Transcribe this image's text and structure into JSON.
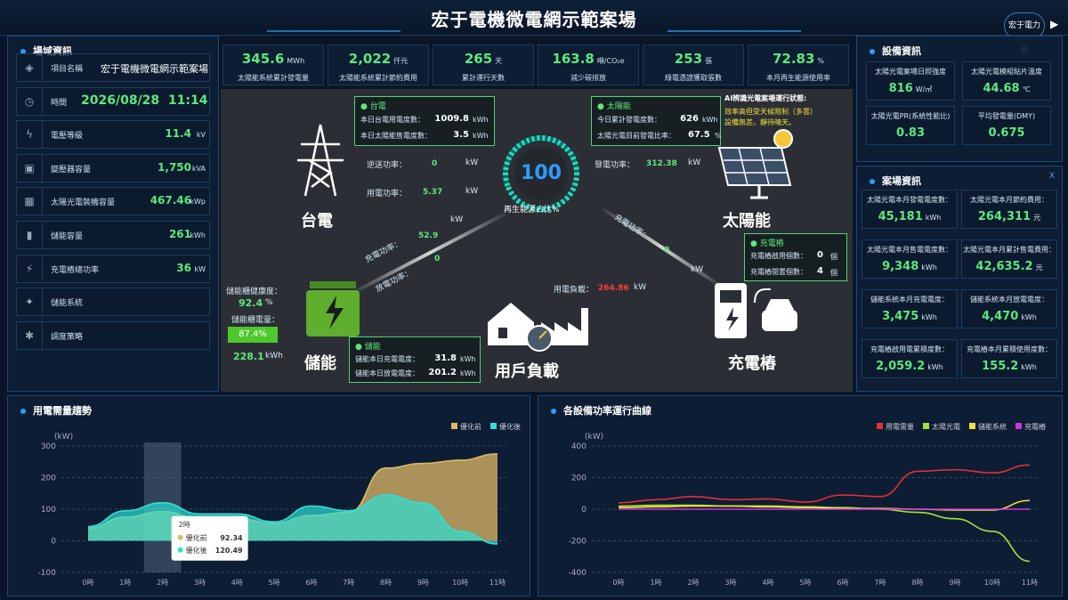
{
  "header": {
    "title": "宏于電機微電網示範案場",
    "brand": "宏于電力會"
  },
  "left": {
    "title": "場域資訊",
    "rows": [
      {
        "icon": "layers-icon",
        "label": "項目名稱",
        "value": "宏于電機微電網示範案場",
        "unit": ""
      },
      {
        "icon": "clock-icon",
        "label": "時間",
        "value": "2026/08/28  11:14",
        "unit": ""
      },
      {
        "icon": "voltage-icon",
        "label": "電壓等級",
        "value": "11.4",
        "unit": "kV"
      },
      {
        "icon": "transformer-icon",
        "label": "變壓器容量",
        "value": "1,750",
        "unit": "kVA"
      },
      {
        "icon": "solar-install-icon",
        "label": "太陽光電裝機容量",
        "value": "467.46",
        "unit": "kWp"
      },
      {
        "icon": "battery-icon",
        "label": "儲能容量",
        "value": "261",
        "unit": "kWh"
      },
      {
        "icon": "charger-icon",
        "label": "充電樁總功率",
        "value": "36",
        "unit": "kW"
      },
      {
        "icon": "storage-system-icon",
        "label": "儲能系統",
        "value": "",
        "unit": ""
      },
      {
        "icon": "strategy-icon",
        "label": "調度策略",
        "value": "",
        "unit": ""
      }
    ]
  },
  "kpis": [
    {
      "value": "345.6",
      "unit": "MWh",
      "label": "太陽能系統累計發電量"
    },
    {
      "value": "2,022",
      "unit": "仟元",
      "label": "太陽能系統累計節約費用"
    },
    {
      "value": "265",
      "unit": "天",
      "label": "累計運行天數"
    },
    {
      "value": "163.8",
      "unit": "噸/CO₂e",
      "label": "減少碳排放"
    },
    {
      "value": "253",
      "unit": "張",
      "label": "綠電憑證獲取張數"
    },
    {
      "value": "72.83",
      "unit": "%",
      "label": "本月再生能源使用率"
    }
  ],
  "flow": {
    "grid": {
      "name": "台電",
      "box_title": "台電",
      "r1": "本日台電用電度數：",
      "v1": "1009.8",
      "u1": "kWh",
      "r2": "本日太陽能售電度數：",
      "v2": "3.5",
      "u2": "kWh",
      "export_label": "逆送功率：",
      "export_value": "0",
      "import_label": "用電功率：",
      "import_value": "5.37",
      "unit": "kW"
    },
    "solar": {
      "name": "太陽能",
      "box_title": "太陽能",
      "r1": "今日累計發電度數：",
      "v1": "626",
      "u1": "kWh",
      "r2": "太陽光電目前發電比率：",
      "v2": "67.5",
      "u2": "%",
      "gen_label": "發電功率：",
      "gen_value": "312.38",
      "unit": "kW"
    },
    "ai": {
      "title": "AI辨識光電案場運行狀態:",
      "msg1": "效率高但受天候限制（多雲）",
      "msg2": "設備無恙，靜待晴天。"
    },
    "renewable": {
      "value": "100",
      "label": "再生能源占比%"
    },
    "storage": {
      "name": "儲能",
      "box_title": "儲能",
      "r1": "儲能本日充電電度：",
      "v1": "31.8",
      "u1": "kWh",
      "r2": "儲能本日放電電度：",
      "v2": "201.2",
      "u2": "kWh",
      "health_label": "儲能櫃健康度：",
      "health_value": "92.4",
      "health_unit": "%",
      "soc_label": "儲能櫃電量：",
      "soc_value": "87.4%",
      "energy_value": "228.1",
      "energy_unit": "kWh",
      "charge_label": "充電功率：",
      "charge_value": "52.9",
      "discharge_label": "放電功率：",
      "discharge_value": "0",
      "unit": "kW"
    },
    "charger": {
      "name": "充電樁",
      "box_title": "充電樁",
      "r1": "充電樁啟用個數：",
      "v1": "0",
      "u1": "個",
      "r2": "充電樁閒置個數：",
      "v2": "4",
      "u2": "個",
      "power_label": "充電功率：",
      "power_value": "0",
      "unit": "kW"
    },
    "load": {
      "name": "用戶負載",
      "label": "用電負載：",
      "value": "264.86",
      "unit": "kW"
    }
  },
  "equipment": {
    "title": "設備資訊",
    "cells": [
      {
        "label": "太陽光電案場日照強度",
        "value": "816",
        "unit": "W/㎡"
      },
      {
        "label": "太陽光電模組貼片溫度",
        "value": "44.68",
        "unit": "℃"
      },
      {
        "label": "太陽光電PR(系統性能比)",
        "value": "0.83",
        "unit": ""
      },
      {
        "label": "平均發電量(DMY)",
        "value": "0.675",
        "unit": ""
      }
    ]
  },
  "site": {
    "title": "案場資訊",
    "close": "X",
    "cells": [
      {
        "label": "太陽光電本月發電電度數：",
        "value": "45,181",
        "unit": "kWh"
      },
      {
        "label": "太陽光電本月節約費用：",
        "value": "264,311",
        "unit": "元"
      },
      {
        "label": "太陽光電本月售電電度數：",
        "value": "9,348",
        "unit": "kWh"
      },
      {
        "label": "太陽光電本月累計售電費用：",
        "value": "42,635.2",
        "unit": "元"
      },
      {
        "label": "儲能系統本月充電電度：",
        "value": "3,475",
        "unit": "kWh"
      },
      {
        "label": "儲能系統本月放電電度：",
        "value": "4,470",
        "unit": "kWh"
      },
      {
        "label": "充電樁啟用電累積度數：",
        "value": "2,059.2",
        "unit": "kWh"
      },
      {
        "label": "充電樁本月累積使用度數：",
        "value": "155.2",
        "unit": "kWh"
      }
    ]
  },
  "colors": {
    "accent": "#2d9cff",
    "green": "#5ee87a",
    "gold": "#e0b868",
    "cyan": "#2ee0d6"
  },
  "chart_data": [
    {
      "type": "area",
      "title": "用電需量趨勢",
      "ylabel": "(kW)",
      "categories": [
        "0時",
        "1時",
        "2時",
        "3時",
        "4時",
        "5時",
        "6時",
        "7時",
        "8時",
        "9時",
        "10時",
        "11時"
      ],
      "ylim": [
        -100,
        300
      ],
      "yticks": [
        -100,
        0,
        100,
        200,
        300
      ],
      "grid": true,
      "legend": "top-right",
      "series": [
        {
          "name": "優化前",
          "color": "#e0b868",
          "values": [
            40,
            75,
            92.34,
            70,
            70,
            55,
            80,
            90,
            230,
            245,
            255,
            275
          ]
        },
        {
          "name": "優化後",
          "color": "#2ee0d6",
          "values": [
            45,
            95,
            120.49,
            85,
            85,
            60,
            110,
            95,
            145,
            120,
            30,
            -10
          ]
        }
      ],
      "tooltip": {
        "title": "2時",
        "rows": [
          {
            "name": "優化前",
            "value": "92.34"
          },
          {
            "name": "優化後",
            "value": "120.49"
          }
        ]
      }
    },
    {
      "type": "line",
      "title": "各設備功率運行曲線",
      "ylabel": "(kW)",
      "categories": [
        "0時",
        "1時",
        "2時",
        "3時",
        "4時",
        "5時",
        "6時",
        "7時",
        "8時",
        "9時",
        "10時",
        "11時"
      ],
      "ylim": [
        -400,
        400
      ],
      "yticks": [
        -400,
        -200,
        0,
        200,
        400
      ],
      "grid": true,
      "legend": "top-right",
      "series": [
        {
          "name": "用電需量",
          "color": "#e0303a",
          "values": [
            40,
            60,
            80,
            60,
            65,
            45,
            90,
            80,
            240,
            250,
            230,
            280
          ]
        },
        {
          "name": "太陽光電",
          "color": "#a8e03a",
          "values": [
            20,
            25,
            25,
            20,
            20,
            15,
            10,
            0,
            -20,
            -60,
            -140,
            -330
          ]
        },
        {
          "name": "儲能系統",
          "color": "#f2e23a",
          "values": [
            10,
            15,
            20,
            20,
            15,
            10,
            5,
            5,
            0,
            -5,
            -5,
            55
          ]
        },
        {
          "name": "充電樁",
          "color": "#c837e0",
          "values": [
            0,
            0,
            0,
            0,
            0,
            0,
            0,
            0,
            0,
            0,
            0,
            0
          ]
        }
      ]
    }
  ]
}
